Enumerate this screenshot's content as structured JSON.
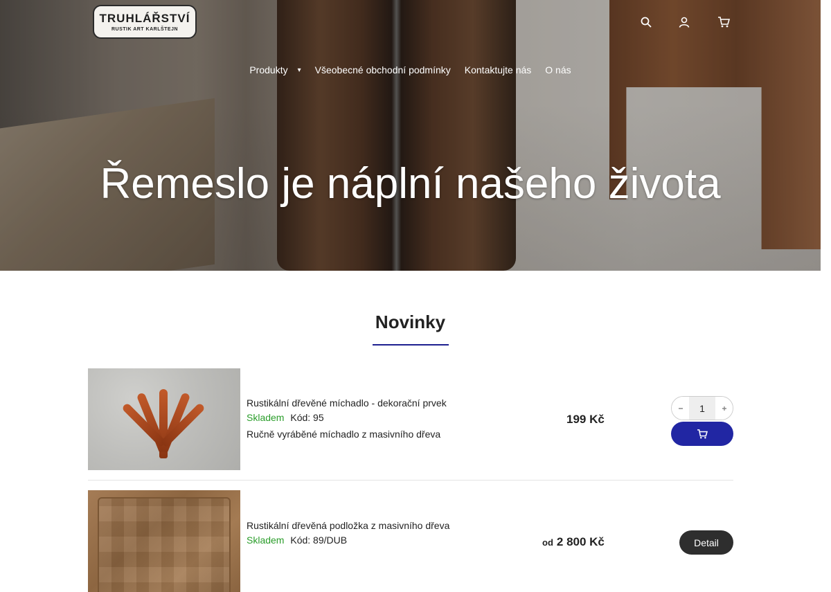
{
  "header": {
    "logo_text": "TRUHLÁŘSTVÍ",
    "logo_subtext": "RUSTIK ART KARLŠTEJN",
    "icons": [
      "search-icon",
      "user-icon",
      "cart-icon"
    ]
  },
  "nav": {
    "items": [
      {
        "label": "Produkty",
        "has_dropdown": true
      },
      {
        "label": "Všeobecné obchodní podmínky"
      },
      {
        "label": "Kontaktujte nás"
      },
      {
        "label": "O nás"
      }
    ]
  },
  "hero": {
    "title": "Řemeslo je náplní našeho života"
  },
  "section": {
    "title": "Novinky"
  },
  "products": [
    {
      "name": "Rustikální dřevěné míchadlo - dekorační prvek",
      "stock": "Skladem",
      "code": "Kód: 95",
      "description": "Ručně vyráběné míchadlo z masivního dřeva",
      "price": "199 Kč",
      "quantity": "1"
    },
    {
      "name": "Rustikální dřevěná podložka z masivního dřeva",
      "stock": "Skladem",
      "code": "Kód: 89/DUB",
      "price_prefix": "od",
      "price": "2 800 Kč",
      "detail_label": "Detail"
    }
  ],
  "colors": {
    "accent": "#2126a3",
    "stock": "#2a9d2a",
    "detail_button": "#2e2e2e"
  }
}
